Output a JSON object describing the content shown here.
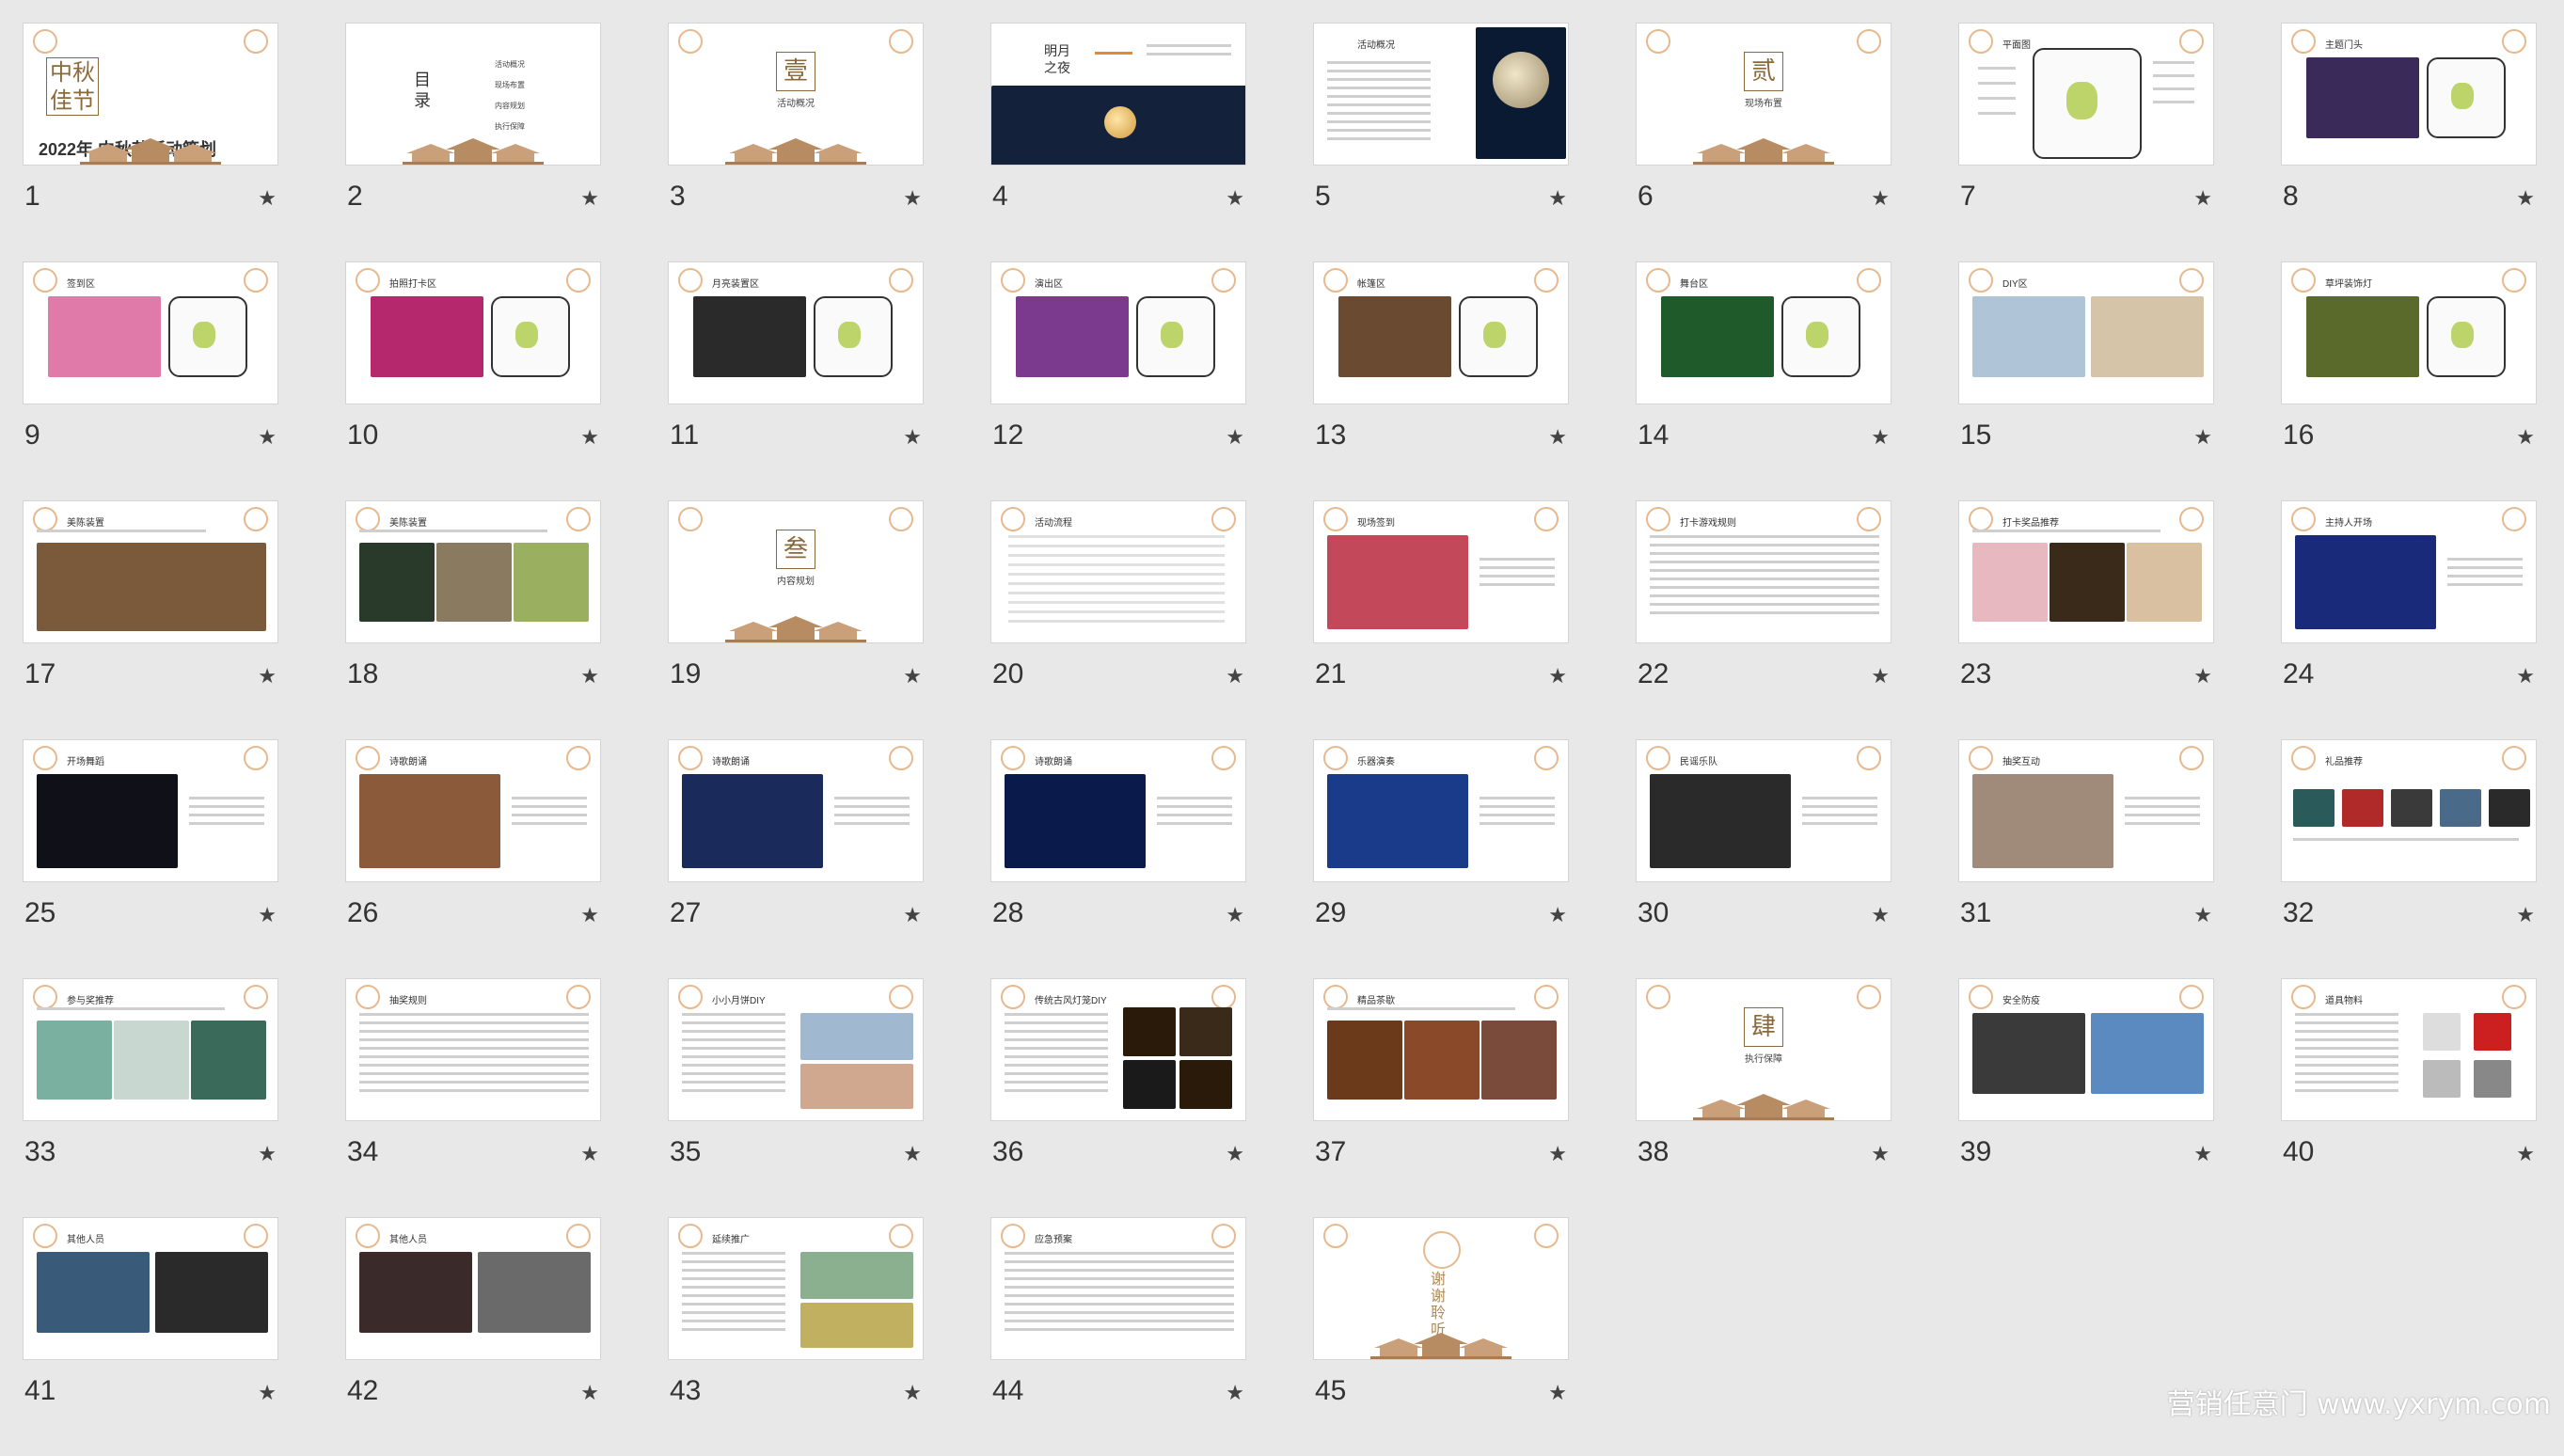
{
  "slides": [
    {
      "num": "1",
      "kind": "cover",
      "title": "中秋佳节",
      "subtitle": "2022年 中秋节活动策划",
      "photos": []
    },
    {
      "num": "2",
      "kind": "menu",
      "title": "目录",
      "menu": [
        "活动概况",
        "现场布置",
        "内容规划",
        "执行保障"
      ],
      "photos": []
    },
    {
      "num": "3",
      "kind": "section",
      "title": "壹",
      "label": "活动概况",
      "photos": []
    },
    {
      "num": "4",
      "kind": "moonnight",
      "title": "明月之夜",
      "photos": []
    },
    {
      "num": "5",
      "kind": "textphoto",
      "title": "活动概况",
      "photos": [
        "#0b1a33"
      ]
    },
    {
      "num": "6",
      "kind": "section",
      "title": "贰",
      "label": "现场布置",
      "photos": []
    },
    {
      "num": "7",
      "kind": "map",
      "title": "平面图",
      "photos": []
    },
    {
      "num": "8",
      "kind": "photomap",
      "title": "主题门头",
      "photos": [
        "#3a2a5a"
      ]
    },
    {
      "num": "9",
      "kind": "photomap",
      "title": "签到区",
      "photos": [
        "#e07aa8"
      ]
    },
    {
      "num": "10",
      "kind": "photomap",
      "title": "拍照打卡区",
      "photos": [
        "#b5286d"
      ]
    },
    {
      "num": "11",
      "kind": "photomap",
      "title": "月亮装置区",
      "photos": [
        "#2a2a2a"
      ]
    },
    {
      "num": "12",
      "kind": "photomap",
      "title": "演出区",
      "photos": [
        "#7b3a8e"
      ]
    },
    {
      "num": "13",
      "kind": "photomap",
      "title": "帐篷区",
      "photos": [
        "#6a4a30"
      ]
    },
    {
      "num": "14",
      "kind": "photomap",
      "title": "舞台区",
      "photos": [
        "#1e5a2a"
      ]
    },
    {
      "num": "15",
      "kind": "photos2",
      "title": "DIY区",
      "photos": [
        "#b0c4d8",
        "#d6c4a8"
      ]
    },
    {
      "num": "16",
      "kind": "photomap",
      "title": "草坪装饰灯",
      "photos": [
        "#5a6a2a"
      ]
    },
    {
      "num": "17",
      "kind": "widephoto",
      "title": "美陈装置",
      "photos": [
        "#7a5a3a"
      ]
    },
    {
      "num": "18",
      "kind": "photos3",
      "title": "美陈装置",
      "photos": [
        "#2a3a2a",
        "#8a7a60",
        "#9ab060"
      ]
    },
    {
      "num": "19",
      "kind": "section",
      "title": "叁",
      "label": "内容规划",
      "photos": []
    },
    {
      "num": "20",
      "kind": "table",
      "title": "活动流程",
      "photos": []
    },
    {
      "num": "21",
      "kind": "phototext",
      "title": "现场签到",
      "photos": [
        "#c2485a"
      ]
    },
    {
      "num": "22",
      "kind": "text",
      "title": "打卡游戏规则",
      "photos": []
    },
    {
      "num": "23",
      "kind": "photos3",
      "title": "打卡奖品推荐",
      "photos": [
        "#e8b8c0",
        "#3a2a1a",
        "#d8c0a0"
      ]
    },
    {
      "num": "24",
      "kind": "phototext",
      "title": "主持人开场",
      "photos": [
        "#1a2a7a"
      ]
    },
    {
      "num": "25",
      "kind": "phototext",
      "title": "开场舞蹈",
      "photos": [
        "#101018"
      ]
    },
    {
      "num": "26",
      "kind": "phototext",
      "title": "诗歌朗诵",
      "photos": [
        "#8a5a3a"
      ]
    },
    {
      "num": "27",
      "kind": "phototext",
      "title": "诗歌朗诵",
      "photos": [
        "#1a2a5a"
      ]
    },
    {
      "num": "28",
      "kind": "phototext",
      "title": "诗歌朗诵",
      "photos": [
        "#0a1a4a"
      ]
    },
    {
      "num": "29",
      "kind": "phototext",
      "title": "乐器演奏",
      "photos": [
        "#1a3a8a"
      ]
    },
    {
      "num": "30",
      "kind": "phototext",
      "title": "民谣乐队",
      "photos": [
        "#2a2a2a"
      ]
    },
    {
      "num": "31",
      "kind": "phototext",
      "title": "抽奖互动",
      "photos": [
        "#a08a7a"
      ]
    },
    {
      "num": "32",
      "kind": "products",
      "title": "礼品推荐",
      "photos": [
        "#2a5a5a",
        "#b02a2a",
        "#3a3a3a",
        "#4a6a8a",
        "#2a2a2a"
      ]
    },
    {
      "num": "33",
      "kind": "photos3",
      "title": "参与奖推荐",
      "photos": [
        "#7ab0a0",
        "#c8d8d0",
        "#3a6a5a"
      ]
    },
    {
      "num": "34",
      "kind": "text",
      "title": "抽奖规则",
      "photos": []
    },
    {
      "num": "35",
      "kind": "textphoto2",
      "title": "小小月饼DIY",
      "photos": [
        "#a0b8d0",
        "#d0a890"
      ]
    },
    {
      "num": "36",
      "kind": "textgrid",
      "title": "传统古风灯笼DIY",
      "photos": [
        "#2a1a0a",
        "#3a2a1a",
        "#1a1a1a",
        "#2a1a0a"
      ]
    },
    {
      "num": "37",
      "kind": "photos3",
      "title": "精品茶歇",
      "photos": [
        "#6a3a1a",
        "#8a4a2a",
        "#7a4a3a"
      ]
    },
    {
      "num": "38",
      "kind": "section",
      "title": "肆",
      "label": "执行保障",
      "photos": []
    },
    {
      "num": "39",
      "kind": "photos2",
      "title": "安全防疫",
      "photos": [
        "#3a3a3a",
        "#5a8ac0"
      ]
    },
    {
      "num": "40",
      "kind": "textproducts",
      "title": "道具物料",
      "photos": [
        "#ffffff"
      ]
    },
    {
      "num": "41",
      "kind": "photos2",
      "title": "其他人员",
      "photos": [
        "#3a5a7a",
        "#2a2a2a"
      ]
    },
    {
      "num": "42",
      "kind": "photos2",
      "title": "其他人员",
      "photos": [
        "#3a2a2a",
        "#6a6a6a"
      ]
    },
    {
      "num": "43",
      "kind": "textphoto2",
      "title": "延续推广",
      "photos": [
        "#8ab090",
        "#c0b060"
      ]
    },
    {
      "num": "44",
      "kind": "text",
      "title": "应急预案",
      "photos": []
    },
    {
      "num": "45",
      "kind": "end",
      "title": "谢谢聆听",
      "photos": []
    }
  ],
  "star_icon": "★",
  "watermark": "营销任意门 www.yxrym.com",
  "colors": {
    "accent": "#8a6a3c",
    "lantern": "#e6b98f",
    "background": "#e8e8e8"
  }
}
